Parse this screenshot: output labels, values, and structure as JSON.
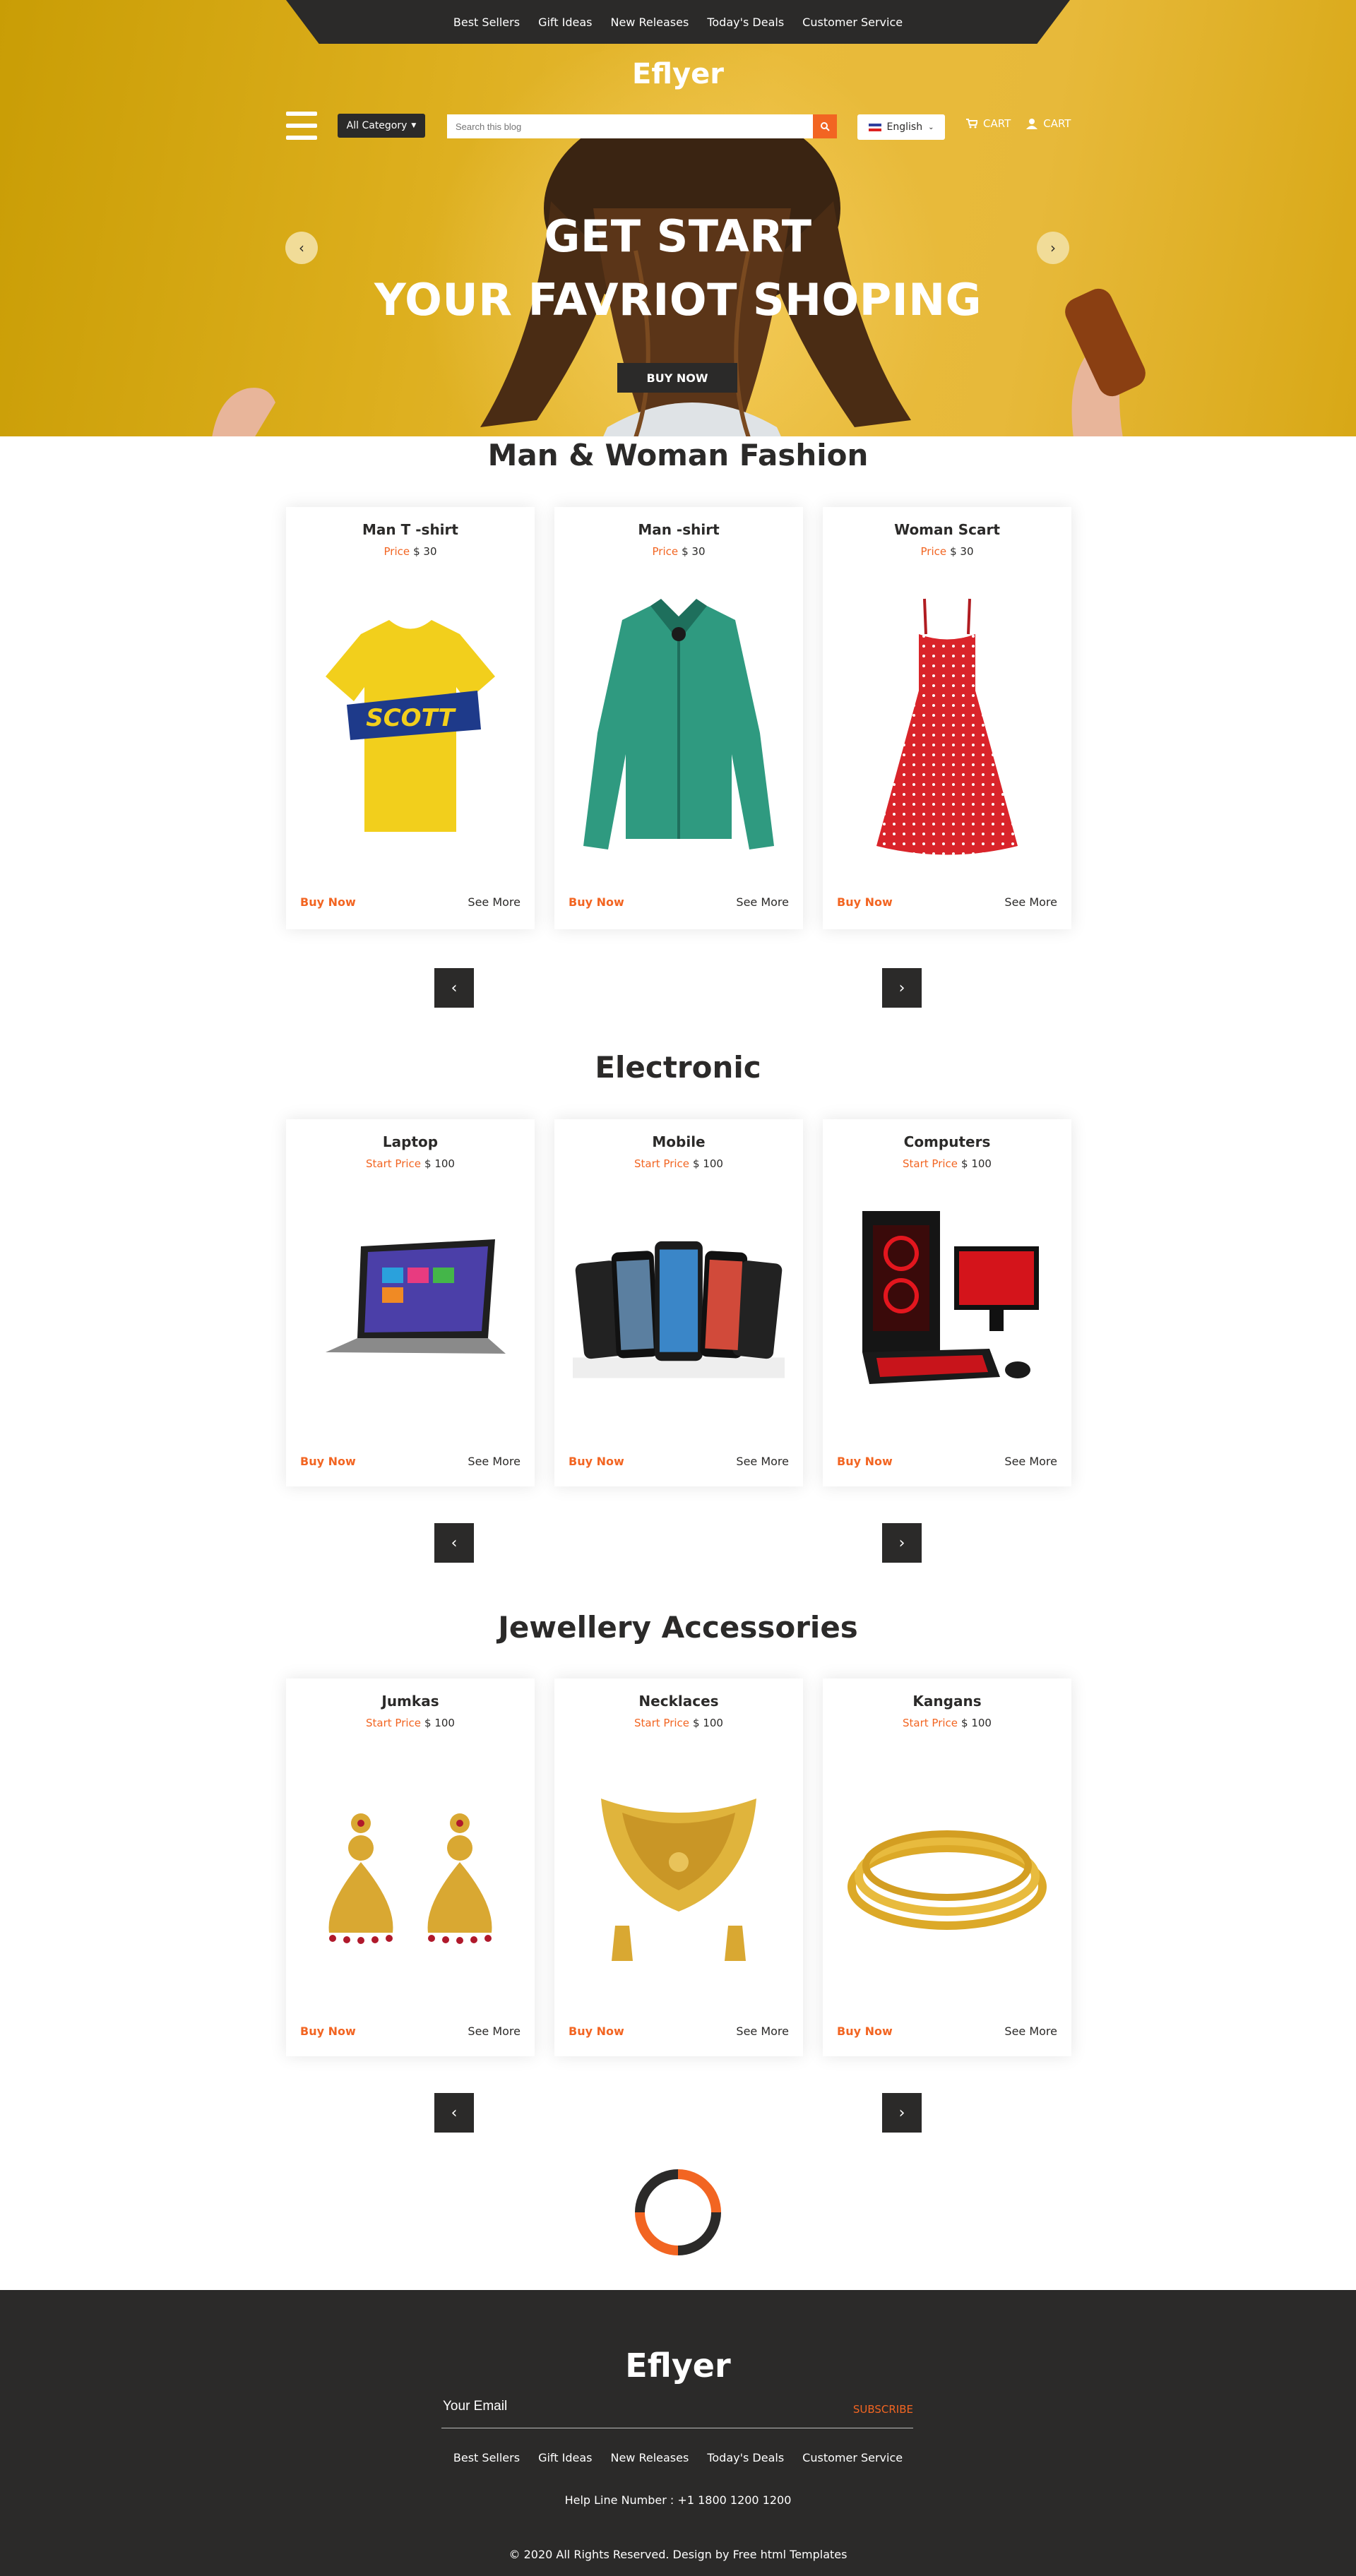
{
  "topnav": [
    "Best Sellers",
    "Gift Ideas",
    "New Releases",
    "Today's Deals",
    "Customer Service"
  ],
  "brand": "Eflyer",
  "header": {
    "category_label": "All Category",
    "search_placeholder": "Search this blog",
    "language": "English",
    "cart_label": "CART",
    "account_label": "CART"
  },
  "hero": {
    "title_line1": "GET START",
    "title_line2": "YOUR FAVRIOT SHOPING",
    "button": "BUY NOW"
  },
  "sections": [
    {
      "title": "Man & Woman Fashion",
      "items": [
        {
          "name": "Man T -shirt",
          "price_label": "Price",
          "price": "$ 30",
          "image": "tshirt"
        },
        {
          "name": "Man -shirt",
          "price_label": "Price",
          "price": "$ 30",
          "image": "shirt"
        },
        {
          "name": "Woman Scart",
          "price_label": "Price",
          "price": "$ 30",
          "image": "dress"
        }
      ]
    },
    {
      "title": "Electronic",
      "items": [
        {
          "name": "Laptop",
          "price_label": "Start Price",
          "price": "$ 100",
          "image": "laptop"
        },
        {
          "name": "Mobile",
          "price_label": "Start Price",
          "price": "$ 100",
          "image": "phones"
        },
        {
          "name": "Computers",
          "price_label": "Start Price",
          "price": "$ 100",
          "image": "computer"
        }
      ]
    },
    {
      "title": "Jewellery Accessories",
      "items": [
        {
          "name": "Jumkas",
          "price_label": "Start Price",
          "price": "$ 100",
          "image": "earrings"
        },
        {
          "name": "Necklaces",
          "price_label": "Start Price",
          "price": "$ 100",
          "image": "necklace"
        },
        {
          "name": "Kangans",
          "price_label": "Start Price",
          "price": "$ 100",
          "image": "bangles"
        }
      ]
    }
  ],
  "card_actions": {
    "buy": "Buy Now",
    "more": "See More"
  },
  "footer": {
    "brand": "Eflyer",
    "email_placeholder": "Your Email",
    "subscribe": "SUBSCRIBE",
    "nav": [
      "Best Sellers",
      "Gift Ideas",
      "New Releases",
      "Today's Deals",
      "Customer Service"
    ],
    "helpline": "Help Line Number : +1 1800 1200 1200",
    "copyright": "© 2020 All Rights Reserved. Design by Free html Templates"
  },
  "colors": {
    "accent": "#f26522",
    "dark": "#2b2a29",
    "hero_yellow": "#e2b32c"
  }
}
